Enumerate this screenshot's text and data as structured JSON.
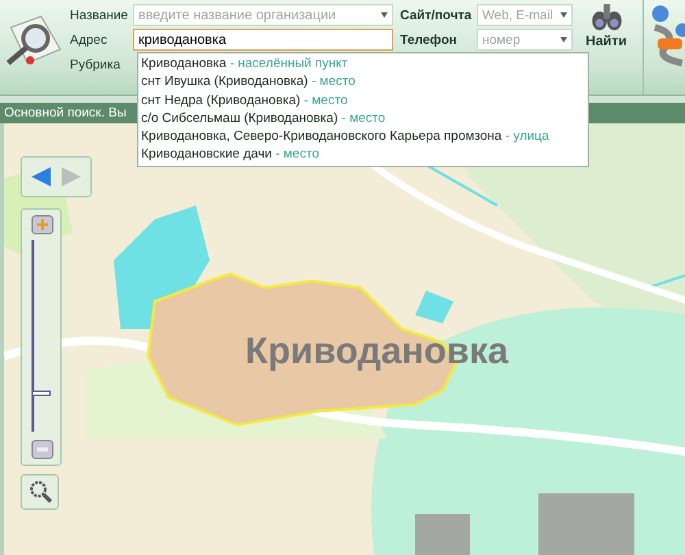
{
  "search_form": {
    "fields": [
      {
        "kind": "input",
        "label": "Название",
        "placeholder": "введите название организации",
        "dropdown": true,
        "focused": false
      },
      {
        "kind": "input",
        "label": "Адрес",
        "value": "криводановка",
        "focused": true
      },
      {
        "kind": "label",
        "label": "Рубрика"
      }
    ],
    "side_fields": [
      {
        "label": "Сайт/почта",
        "placeholder": "Web, E-mail"
      },
      {
        "label": "Телефон",
        "placeholder": "номер"
      }
    ],
    "find_button": "Найти"
  },
  "suggestions": [
    {
      "name": "Криводановка",
      "separator": "-",
      "type": "населённый пункт"
    },
    {
      "name": "снт Ивушка (Криводановка)",
      "separator": "-",
      "type": "место"
    },
    {
      "name": "снт Недра (Криводановка)",
      "separator": "-",
      "type": "место"
    },
    {
      "name": "с/о Сибсельмаш (Криводановка)",
      "separator": "-",
      "type": "место"
    },
    {
      "name": "Криводановка, Северо-Криводановского Карьера промзона",
      "separator": "-",
      "type": "улица"
    },
    {
      "name": "Криводановские дачи",
      "separator": "-",
      "type": "место"
    }
  ],
  "status_bar": "Основной поиск. Вы",
  "map": {
    "place_label": "Криводановка",
    "zoom": {
      "level": 0.2
    }
  }
}
